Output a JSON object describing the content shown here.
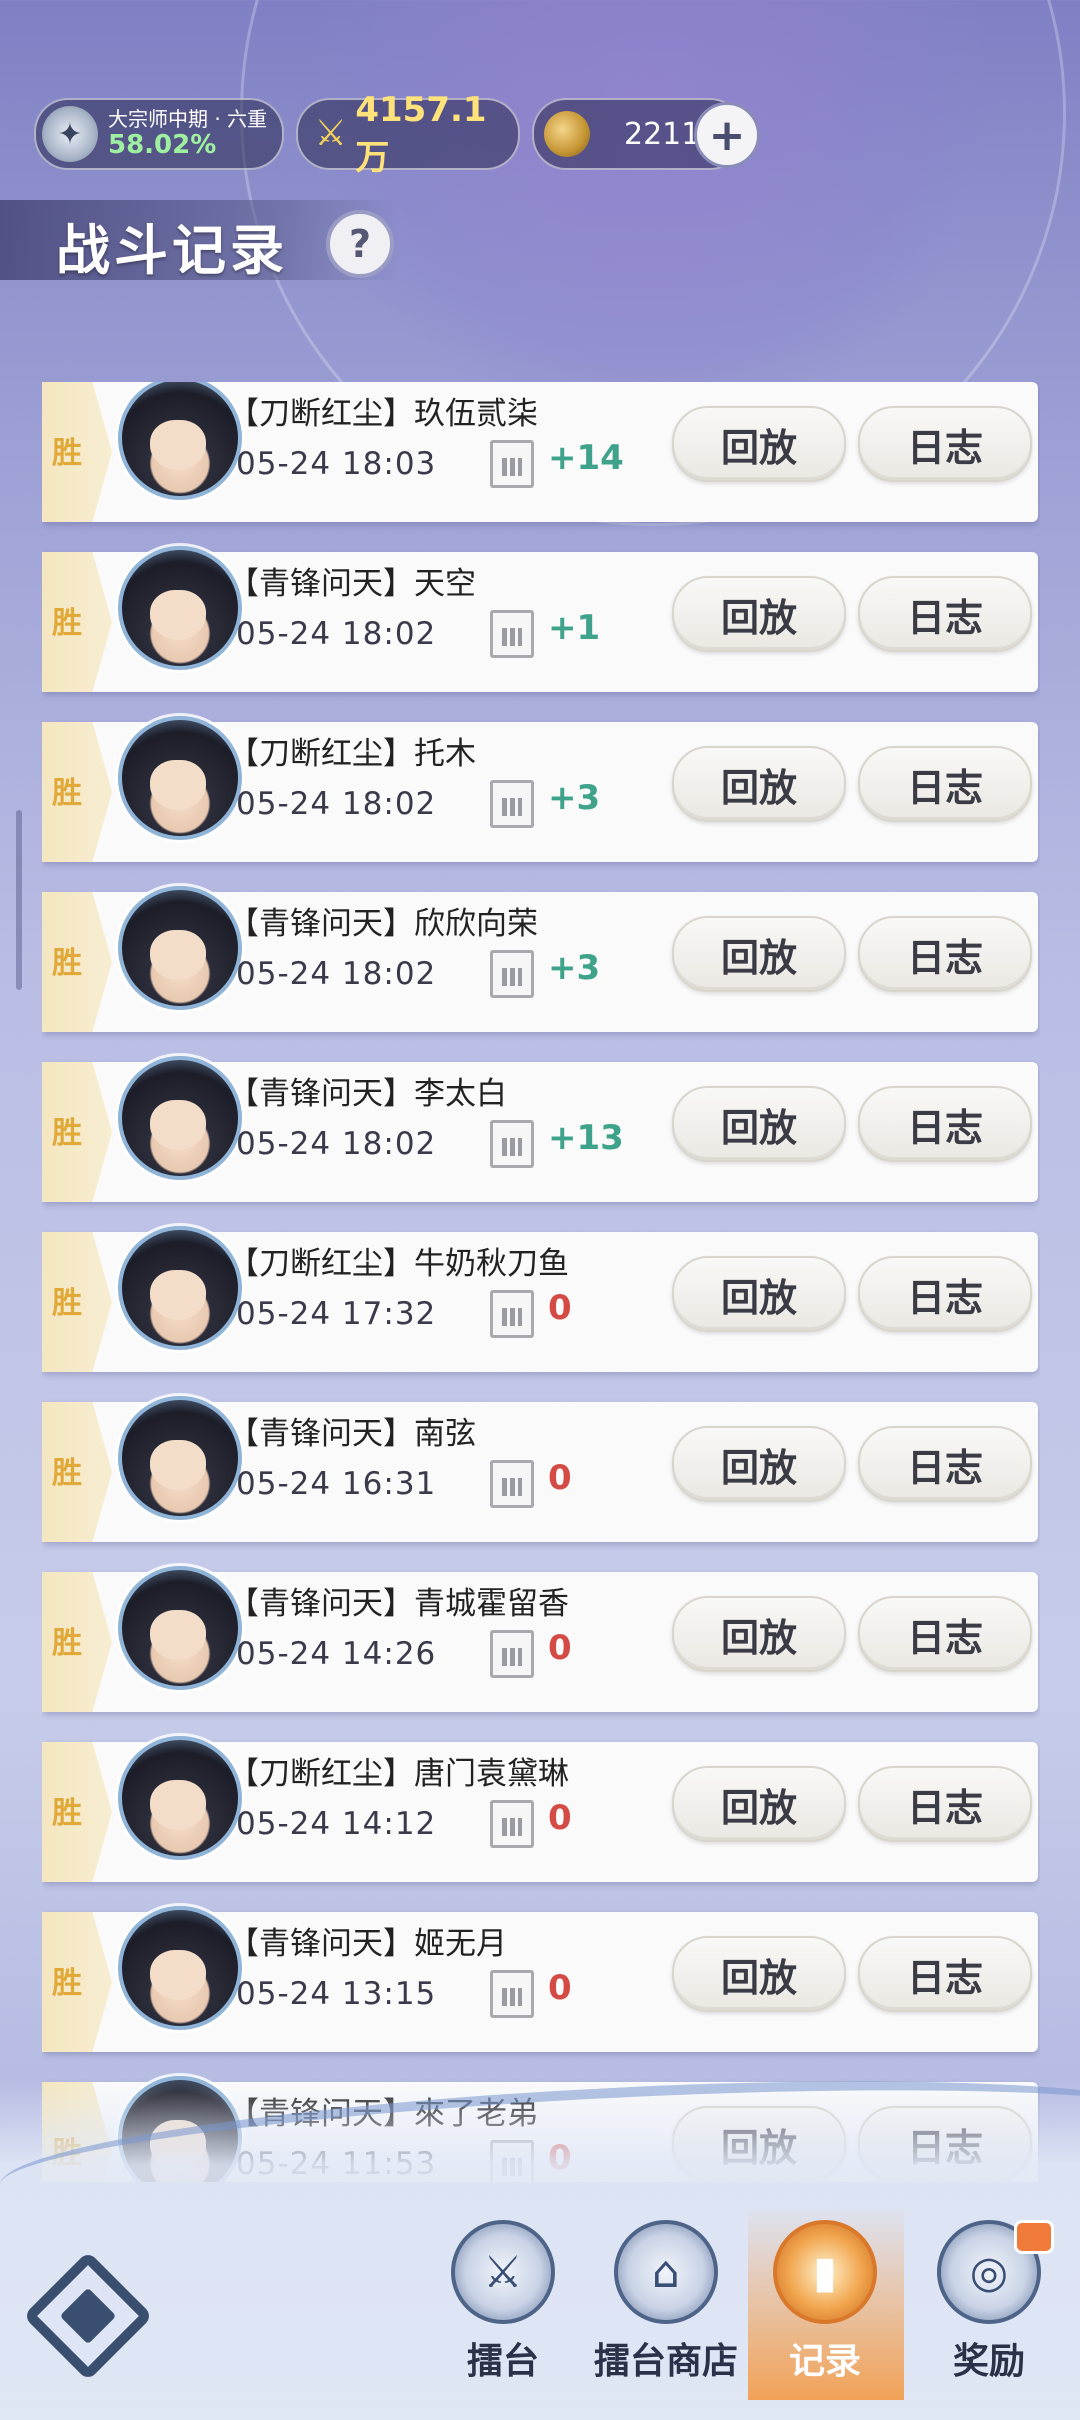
{
  "header": {
    "rank_name": "大宗师中期 · 六重",
    "rank_progress": "58.02%",
    "power": "4157.1万",
    "currency": "2211",
    "plus_label": "+",
    "page_title": "战斗记录",
    "help_label": "?"
  },
  "records": [
    {
      "result": "胜",
      "name": "【刀断红尘】玖伍贰柒",
      "time": "05-24 18:03",
      "score": "+14",
      "replay": "回放",
      "log": "日志"
    },
    {
      "result": "胜",
      "name": "【青锋问天】天空",
      "time": "05-24 18:02",
      "score": "+1",
      "replay": "回放",
      "log": "日志"
    },
    {
      "result": "胜",
      "name": "【刀断红尘】托木",
      "time": "05-24 18:02",
      "score": "+3",
      "replay": "回放",
      "log": "日志"
    },
    {
      "result": "胜",
      "name": "【青锋问天】欣欣向荣",
      "time": "05-24 18:02",
      "score": "+3",
      "replay": "回放",
      "log": "日志"
    },
    {
      "result": "胜",
      "name": "【青锋问天】李太白",
      "time": "05-24 18:02",
      "score": "+13",
      "replay": "回放",
      "log": "日志"
    },
    {
      "result": "胜",
      "name": "【刀断红尘】牛奶秋刀鱼",
      "time": "05-24 17:32",
      "score": "0",
      "replay": "回放",
      "log": "日志"
    },
    {
      "result": "胜",
      "name": "【青锋问天】南弦",
      "time": "05-24 16:31",
      "score": "0",
      "replay": "回放",
      "log": "日志"
    },
    {
      "result": "胜",
      "name": "【青锋问天】青城霍留香",
      "time": "05-24 14:26",
      "score": "0",
      "replay": "回放",
      "log": "日志"
    },
    {
      "result": "胜",
      "name": "【刀断红尘】唐门袁黛琳",
      "time": "05-24 14:12",
      "score": "0",
      "replay": "回放",
      "log": "日志"
    },
    {
      "result": "胜",
      "name": "【青锋问天】姬无月",
      "time": "05-24 13:15",
      "score": "0",
      "replay": "回放",
      "log": "日志"
    },
    {
      "result": "胜",
      "name": "【青锋问天】來了老弟",
      "time": "05-24 11:53",
      "score": "0",
      "replay": "回放",
      "log": "日志"
    }
  ],
  "nav": {
    "items": [
      {
        "label": "擂台",
        "icon": "arena-icon"
      },
      {
        "label": "擂台商店",
        "icon": "shop-icon"
      },
      {
        "label": "记录",
        "icon": "record-icon"
      },
      {
        "label": "奖励",
        "icon": "reward-icon"
      }
    ],
    "active": "记录"
  },
  "colors": {
    "score_positive": "#3fa28a",
    "score_zero": "#d44a44",
    "win_text": "#e0a93a",
    "active_nav": "#f0a44c"
  }
}
